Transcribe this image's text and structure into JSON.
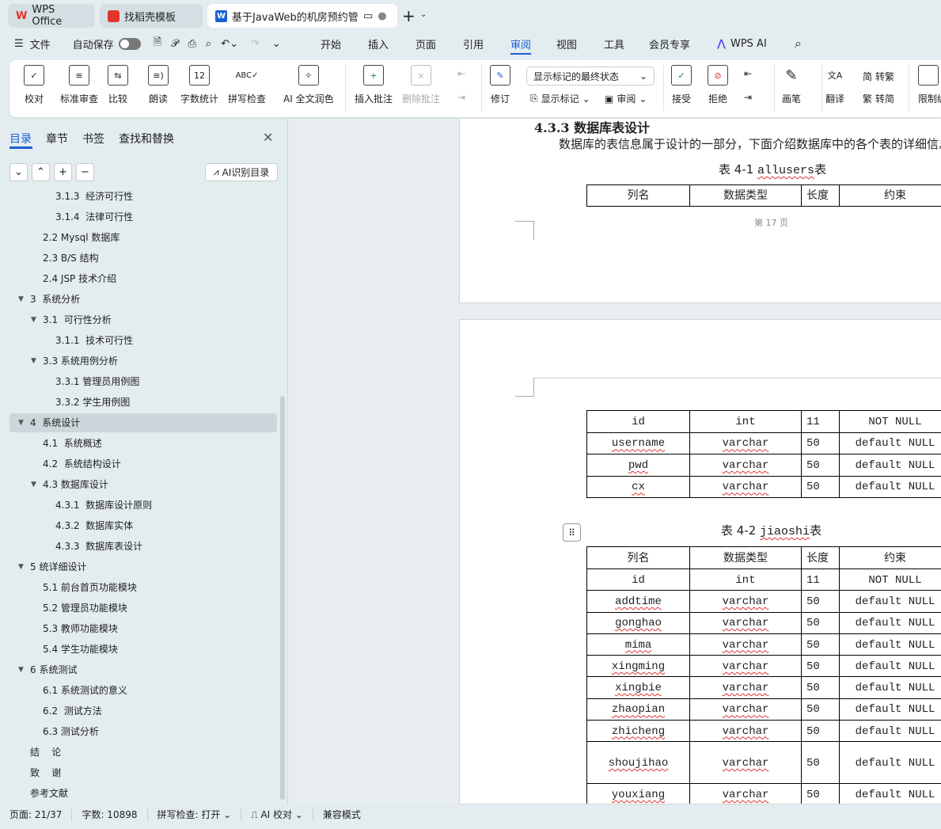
{
  "tabs": [
    {
      "label": "WPS Office",
      "icon": "wps-logo-icon"
    },
    {
      "label": "找稻壳模板",
      "icon": "docer-icon"
    },
    {
      "label": "基于JavaWeb的机房预约管理",
      "icon": "word-doc-icon",
      "active": true
    }
  ],
  "menu": {
    "file": "文件",
    "autosave": "自动保存",
    "autosave_on": false,
    "items": [
      "开始",
      "插入",
      "页面",
      "引用",
      "审阅",
      "视图",
      "工具",
      "会员专享"
    ],
    "active": "审阅",
    "wps_ai": "WPS AI"
  },
  "ribbon": {
    "buttons": [
      "校对",
      "标准审查",
      "比较",
      "朗读",
      "字数统计",
      "拼写检查",
      "AI 全文润色",
      "插入批注",
      "删除批注",
      "修订",
      "接受",
      "拒绝",
      "画笔",
      "翻译",
      "限制编辑"
    ],
    "markup_select": "显示标记的最终状态",
    "show_markup": "显示标记",
    "review": "审阅",
    "to_traditional": "转繁",
    "to_simplified": "转简"
  },
  "panel": {
    "tabs": [
      "目录",
      "章节",
      "书签",
      "查找和替换"
    ],
    "active_tab": "目录",
    "ai_toc": "AI识别目录",
    "toc": [
      {
        "label": "3.1.3  经济可行性",
        "level": 3
      },
      {
        "label": "3.1.4  法律可行性",
        "level": 3
      },
      {
        "label": "2.2 Mysql 数据库",
        "level": 2
      },
      {
        "label": "2.3 B/S 结构",
        "level": 2
      },
      {
        "label": "2.4 JSP 技术介绍",
        "level": 2
      },
      {
        "label": "3  系统分析",
        "level": 1,
        "expanded": true
      },
      {
        "label": "3.1  可行性分析",
        "level": 2,
        "expanded": true
      },
      {
        "label": "3.1.1  技术可行性",
        "level": 3
      },
      {
        "label": "3.3 系统用例分析",
        "level": 2,
        "expanded": true
      },
      {
        "label": "3.3.1 管理员用例图",
        "level": 3
      },
      {
        "label": "3.3.2 学生用例图",
        "level": 3
      },
      {
        "label": "4  系统设计",
        "level": 1,
        "expanded": true,
        "selected": true
      },
      {
        "label": "4.1  系统概述",
        "level": 2
      },
      {
        "label": "4.2  系统结构设计",
        "level": 2
      },
      {
        "label": "4.3 数据库设计",
        "level": 2,
        "expanded": true
      },
      {
        "label": "4.3.1  数据库设计原则",
        "level": 3
      },
      {
        "label": "4.3.2  数据库实体",
        "level": 3
      },
      {
        "label": "4.3.3  数据库表设计",
        "level": 3
      },
      {
        "label": "5 统详细设计",
        "level": 1,
        "expanded": true
      },
      {
        "label": "5.1 前台首页功能模块",
        "level": 2
      },
      {
        "label": "5.2 管理员功能模块",
        "level": 2
      },
      {
        "label": "5.3 教师功能模块",
        "level": 2
      },
      {
        "label": "5.4 学生功能模块",
        "level": 2
      },
      {
        "label": "6 系统测试",
        "level": 1,
        "expanded": true
      },
      {
        "label": "6.1 系统测试的意义",
        "level": 2
      },
      {
        "label": "6.2  测试方法",
        "level": 2
      },
      {
        "label": "6.3 测试分析",
        "level": 2
      },
      {
        "label": "结    论",
        "level": 1
      },
      {
        "label": "致    谢",
        "level": 1
      },
      {
        "label": "参考文献",
        "level": 1
      }
    ]
  },
  "doc": {
    "heading": "4.3.3  数据库表设计",
    "para": "数据库的表信息属于设计的一部分，下面介绍数据库中的各个表的详细信息。",
    "table1_caption": [
      "表 4-1 ",
      "allusers",
      "表"
    ],
    "headers": [
      "列名",
      "数据类型",
      "长度",
      "约束"
    ],
    "page_footer": "第 17 页",
    "table1_rows": [
      [
        "id",
        "int",
        "11",
        "NOT NULL"
      ],
      [
        "username",
        "varchar",
        "50",
        "default NULL"
      ],
      [
        "pwd",
        "varchar",
        "50",
        "default NULL"
      ],
      [
        "cx",
        "varchar",
        "50",
        "default NULL"
      ]
    ],
    "table2_caption": [
      "表 4-2 ",
      "jiaoshi",
      "表"
    ],
    "table2_rows": [
      [
        "id",
        "int",
        "11",
        "NOT NULL"
      ],
      [
        "addtime",
        "varchar",
        "50",
        "default NULL"
      ],
      [
        "gonghao",
        "varchar",
        "50",
        "default NULL"
      ],
      [
        "mima",
        "varchar",
        "50",
        "default NULL"
      ],
      [
        "xingming",
        "varchar",
        "50",
        "default NULL"
      ],
      [
        "xingbie",
        "varchar",
        "50",
        "default NULL"
      ],
      [
        "zhaopian",
        "varchar",
        "50",
        "default NULL"
      ],
      [
        "zhicheng",
        "varchar",
        "50",
        "default NULL"
      ],
      [
        "shoujihao",
        "varchar",
        "50",
        "default NULL"
      ],
      [
        "youxiang",
        "varchar",
        "50",
        "default NULL"
      ]
    ]
  },
  "status": {
    "page": "页面: 21/37",
    "words": "字数: 10898",
    "spell": "拼写检查: 打开",
    "ai_check": "AI 校对",
    "compat": "兼容模式"
  },
  "colors": {
    "accent": "#1c5fd6",
    "wps_red": "#e0352b",
    "spellcheck": "#d33"
  }
}
